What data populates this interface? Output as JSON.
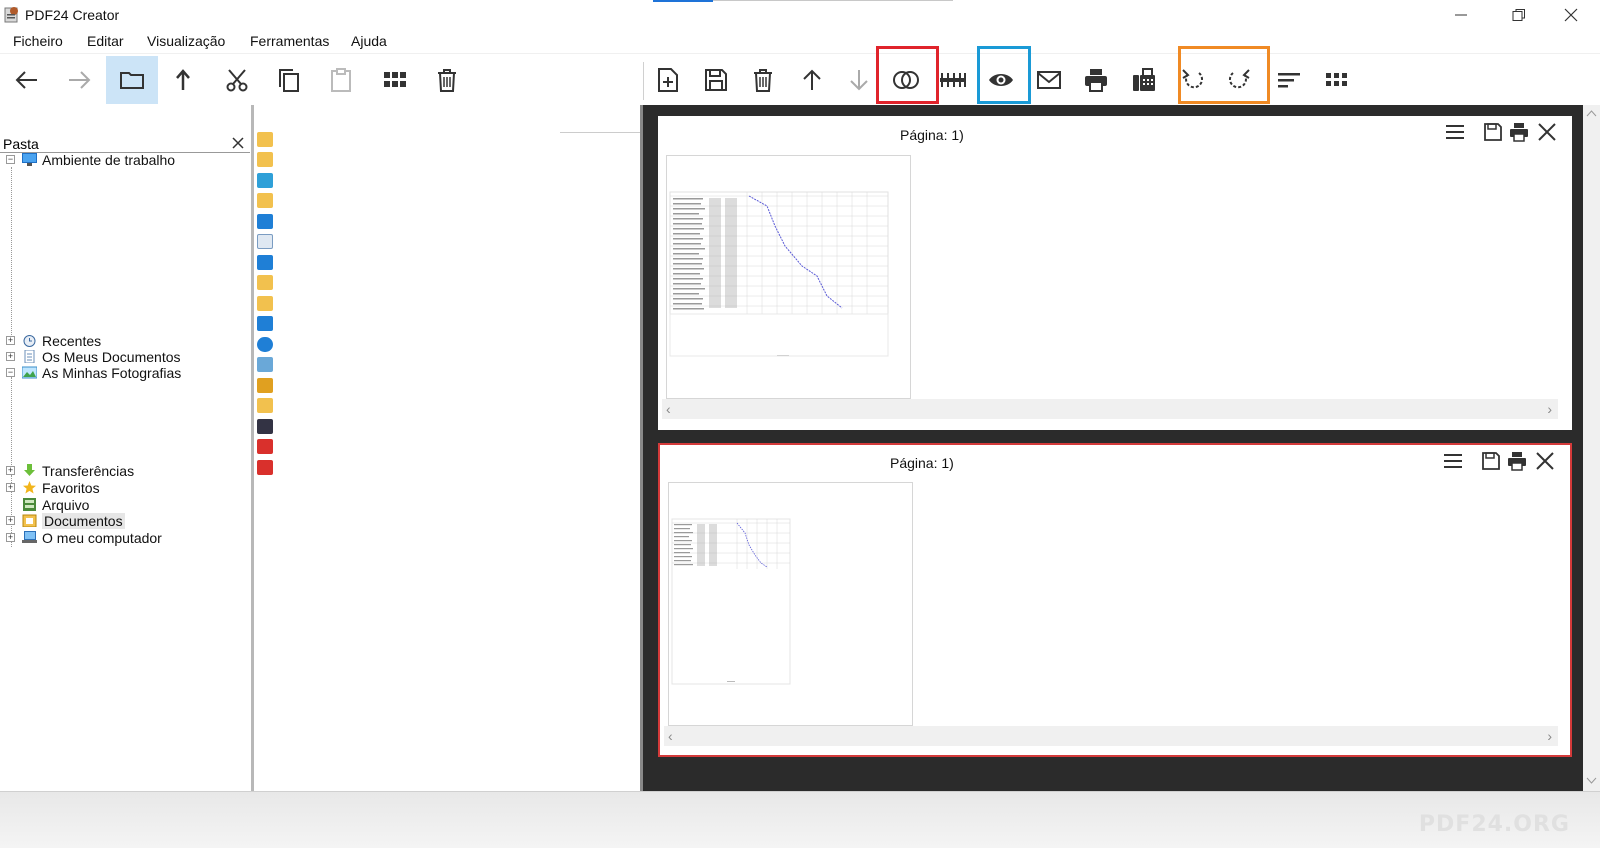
{
  "window": {
    "title": "PDF24 Creator"
  },
  "menu": [
    "Ficheiro",
    "Editar",
    "Visualização",
    "Ferramentas",
    "Ajuda"
  ],
  "toolbar_left": [
    "back",
    "forward",
    "folder-view",
    "up-folder",
    "cut",
    "copy",
    "paste",
    "grid-view",
    "delete"
  ],
  "toolbar_right": [
    "new-document",
    "save",
    "delete",
    "move-up",
    "move-down",
    "merge",
    "split",
    "preview",
    "email",
    "print",
    "fax",
    "rotate-left",
    "rotate-right",
    "sort",
    "apps"
  ],
  "highlight_colors": {
    "merge": "#e0232b",
    "preview": "#1a9ad6",
    "rotate": "#f08a24"
  },
  "folder_panel": {
    "header": "Pasta",
    "items": [
      {
        "label": "Ambiente de trabalho",
        "expander": "−",
        "icon": "desktop-icon"
      },
      {
        "label": "Recentes",
        "expander": "+",
        "icon": "clock-icon"
      },
      {
        "label": "Os Meus Documentos",
        "expander": "+",
        "icon": "documents-icon"
      },
      {
        "label": "As Minhas Fotografias",
        "expander": "−",
        "icon": "pictures-icon"
      },
      {
        "label": "Transferências",
        "expander": "+",
        "icon": "download-icon"
      },
      {
        "label": "Favoritos",
        "expander": "+",
        "icon": "star-icon"
      },
      {
        "label": "Arquivo",
        "expander": "",
        "icon": "archive-icon"
      },
      {
        "label": "Documentos",
        "expander": "+",
        "icon": "library-icon"
      },
      {
        "label": "O meu computador",
        "expander": "+",
        "icon": "computer-icon"
      }
    ]
  },
  "documents": [
    {
      "page_label": "Página: 1)",
      "selected": false
    },
    {
      "page_label": "Página: 1)",
      "selected": true
    }
  ],
  "brand": "PDF24.ORG"
}
